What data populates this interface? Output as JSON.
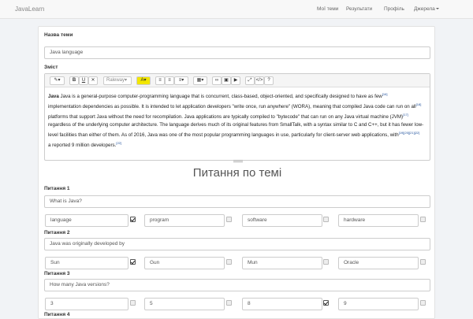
{
  "navbar": {
    "brand": "JavaLearn",
    "links": [
      "Мої теми",
      "Результати",
      "Профіль",
      "Джерела"
    ]
  },
  "form": {
    "title_label": "Назва теми",
    "title_value": "Java language",
    "content_label": "Зміст",
    "toolbar": {
      "font_select": "Raleway",
      "buttons": [
        "magic-icon",
        "bold-icon",
        "underline-icon",
        "eraser-icon",
        "font-icon",
        "color-icon",
        "list-ul-icon",
        "list-ol-icon",
        "align-icon",
        "table-icon",
        "link-icon",
        "picture-icon",
        "video-icon",
        "fullscreen-icon",
        "code-icon",
        "help-icon"
      ]
    },
    "editor_lines": [
      "Java is a general-purpose computer-programming language that is concurrent, class-based, object-oriented, and specifically designed to have as few",
      "implementation dependencies as possible. It is intended to let application developers \"write once, run anywhere\" (WORA), meaning that compiled Java code can run on all",
      "platforms that support Java without the need for recompilation. Java applications are typically compiled to \"bytecode\" that can run on any Java virtual machine (JVM)",
      "regardless of the underlying computer architecture. The language derives much of its original features from SmallTalk, with a syntax similar to C and C++, but it has fewer low-",
      "level facilities than either of them. As of 2016, Java was one of the most popular programming languages in use, particularly for client-server web applications, with",
      "a reported 9 million developers."
    ],
    "editor_refs": [
      "[16]",
      "[18]",
      "[17]",
      "[19][20][21][22]",
      "[22]"
    ]
  },
  "questions_title": "Питання по темі",
  "questions": [
    {
      "label": "Питання 1",
      "text": "What is Java?",
      "answers": [
        {
          "text": "language",
          "checked": true
        },
        {
          "text": "program",
          "checked": false
        },
        {
          "text": "software",
          "checked": false
        },
        {
          "text": "hardware",
          "checked": false
        }
      ]
    },
    {
      "label": "Питання 2",
      "text": "Java was originally developed by",
      "answers": [
        {
          "text": "Sun",
          "checked": true
        },
        {
          "text": "Gun",
          "checked": false
        },
        {
          "text": "Mun",
          "checked": false
        },
        {
          "text": "Oracle",
          "checked": false
        }
      ]
    },
    {
      "label": "Питання 3",
      "text": "How many Java versions?",
      "answers": [
        {
          "text": "3",
          "checked": false
        },
        {
          "text": "5",
          "checked": false
        },
        {
          "text": "8",
          "checked": true
        },
        {
          "text": "9",
          "checked": false
        }
      ]
    },
    {
      "label": "Питання 4",
      "text": "",
      "answers": []
    }
  ]
}
